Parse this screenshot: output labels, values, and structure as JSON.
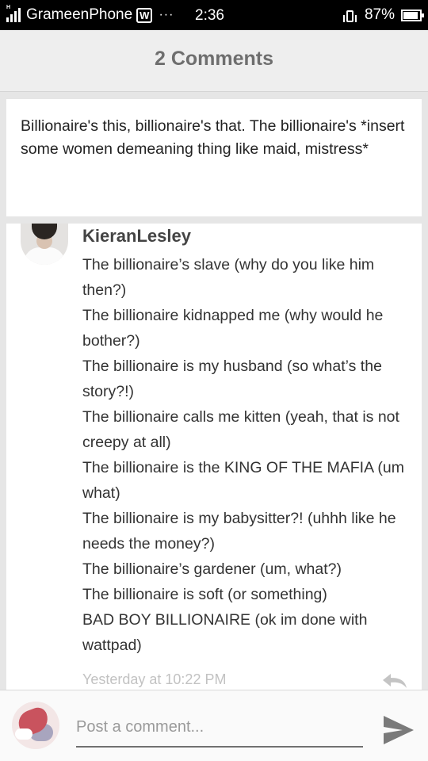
{
  "status_bar": {
    "carrier": "GrameenPhone",
    "network_badge": "W",
    "more_dots": "···",
    "time": "2:36",
    "signal_h": "H",
    "battery_percent": "87%",
    "battery_level": 0.87
  },
  "header": {
    "title": "2 Comments"
  },
  "story": {
    "text": "Billionaire's this, billionaire's that. The billionaire's *insert some women demeaning thing like maid, mistress*"
  },
  "comment": {
    "author": "KieranLesley",
    "lines": [
      "The billionaire’s slave (why do you like him then?)",
      "The billionaire kidnapped me (why would he bother?)",
      "The billionaire is my husband (so what’s the story?!)",
      "The billionaire calls me kitten (yeah, that is not creepy at all)",
      "The billionaire is the KING OF THE MAFIA (um what)",
      "The billionaire is my babysitter?! (uhhh like he needs the money?)",
      "The billionaire’s gardener (um, what?)",
      "The billionaire is soft (or something)",
      "BAD BOY BILLIONAIRE (ok im done with wattpad)"
    ],
    "timestamp": "Yesterday at 10:22 PM"
  },
  "compose": {
    "placeholder": "Post a comment..."
  },
  "icons": {
    "reply": "reply-icon",
    "send": "send-icon"
  },
  "colors": {
    "header_bg": "#eeeeee",
    "page_bg": "#e6e6e6",
    "title_text": "#6e6e6e",
    "timestamp_text": "#c2c2c2"
  }
}
